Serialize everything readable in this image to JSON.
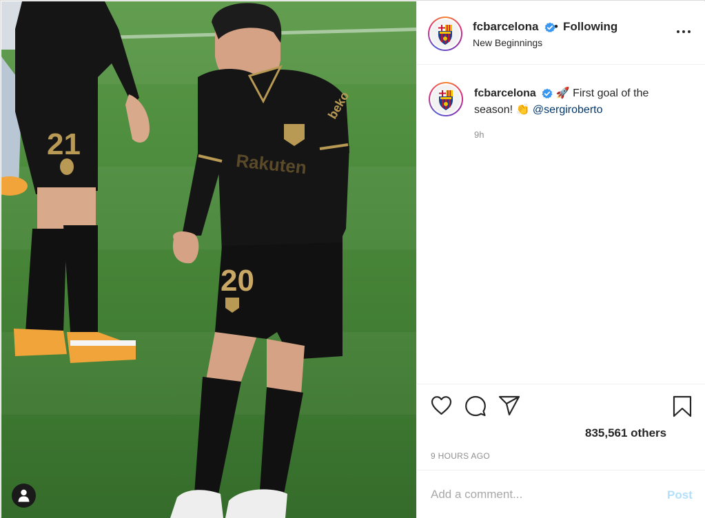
{
  "post": {
    "username": "fcbarcelona",
    "follow_separator": "•",
    "follow_state": "Following",
    "location": "New Beginnings",
    "caption": {
      "username": "fcbarcelona",
      "emoji_rocket": "🚀",
      "text": "First goal of the season!",
      "emoji_clap": "👏",
      "mention": "@sergiroberto"
    },
    "time_ago": "9h",
    "likes_text": "835,561 others",
    "date_label": "9 HOURS AGO",
    "comment": {
      "placeholder": "Add a comment...",
      "value": ""
    },
    "post_button": "Post"
  },
  "photo": {
    "subject": "soccer player in black kit number 20 celebrating",
    "kit_numbers": [
      "21",
      "20"
    ],
    "kit_sponsor": "Rakuten"
  },
  "icons": {
    "more": "more-options-icon",
    "like": "heart-icon",
    "comment": "comment-icon",
    "share": "share-icon",
    "save": "bookmark-icon",
    "verified": "verified-badge-icon",
    "tags": "person-tag-icon"
  },
  "colors": {
    "verified_blue": "#3897f0",
    "mention": "#00376b",
    "post_disabled": "#b2dffc",
    "muted": "#8e8e8e"
  }
}
